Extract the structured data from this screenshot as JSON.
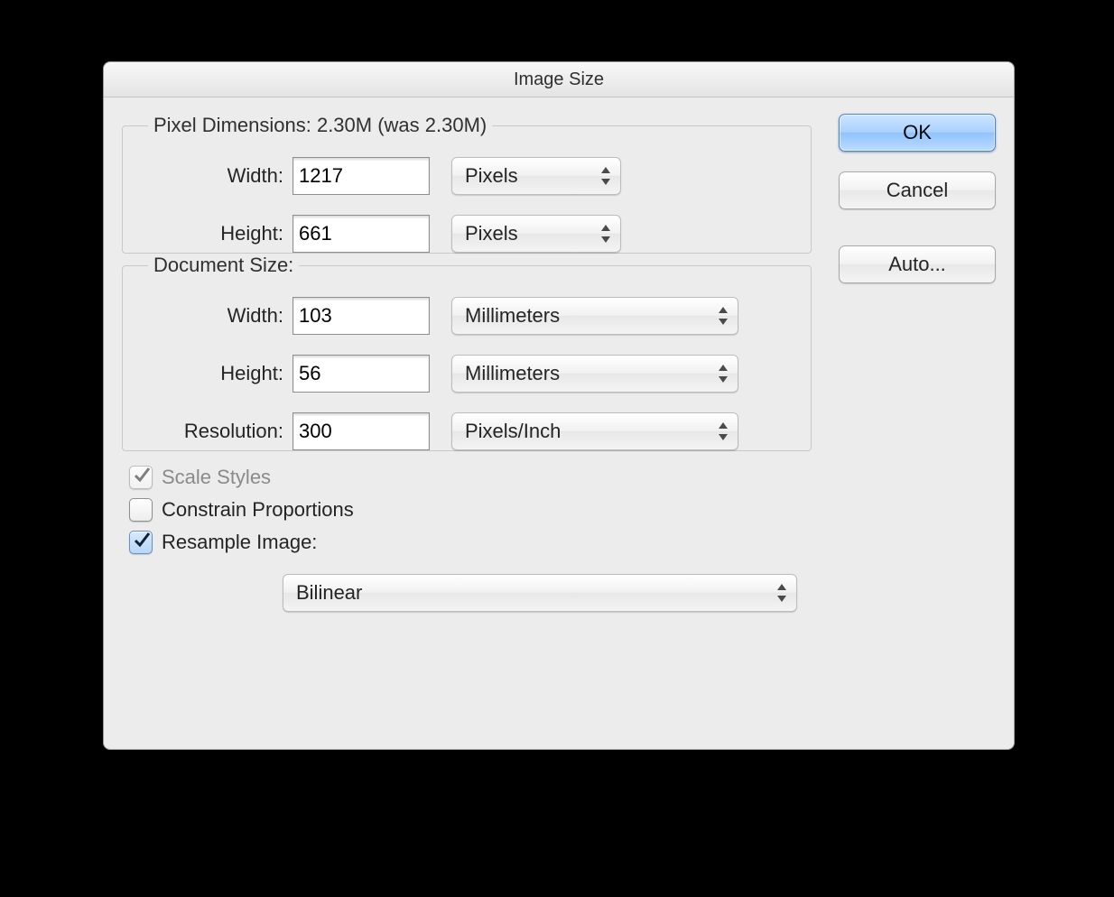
{
  "title": "Image Size",
  "pixelDimensions": {
    "legend": "Pixel Dimensions:  2.30M (was 2.30M)",
    "widthLabel": "Width:",
    "widthValue": "1217",
    "widthUnit": "Pixels",
    "heightLabel": "Height:",
    "heightValue": "661",
    "heightUnit": "Pixels"
  },
  "documentSize": {
    "legend": "Document Size:",
    "widthLabel": "Width:",
    "widthValue": "103",
    "widthUnit": "Millimeters",
    "heightLabel": "Height:",
    "heightValue": "56",
    "heightUnit": "Millimeters",
    "resolutionLabel": "Resolution:",
    "resolutionValue": "300",
    "resolutionUnit": "Pixels/Inch"
  },
  "options": {
    "scaleStyles": {
      "label": "Scale Styles",
      "checked": true,
      "enabled": false
    },
    "constrain": {
      "label": "Constrain Proportions",
      "checked": false,
      "enabled": true
    },
    "resample": {
      "label": "Resample Image:",
      "checked": true,
      "enabled": true
    },
    "resampleMethod": "Bilinear"
  },
  "buttons": {
    "ok": "OK",
    "cancel": "Cancel",
    "auto": "Auto..."
  }
}
